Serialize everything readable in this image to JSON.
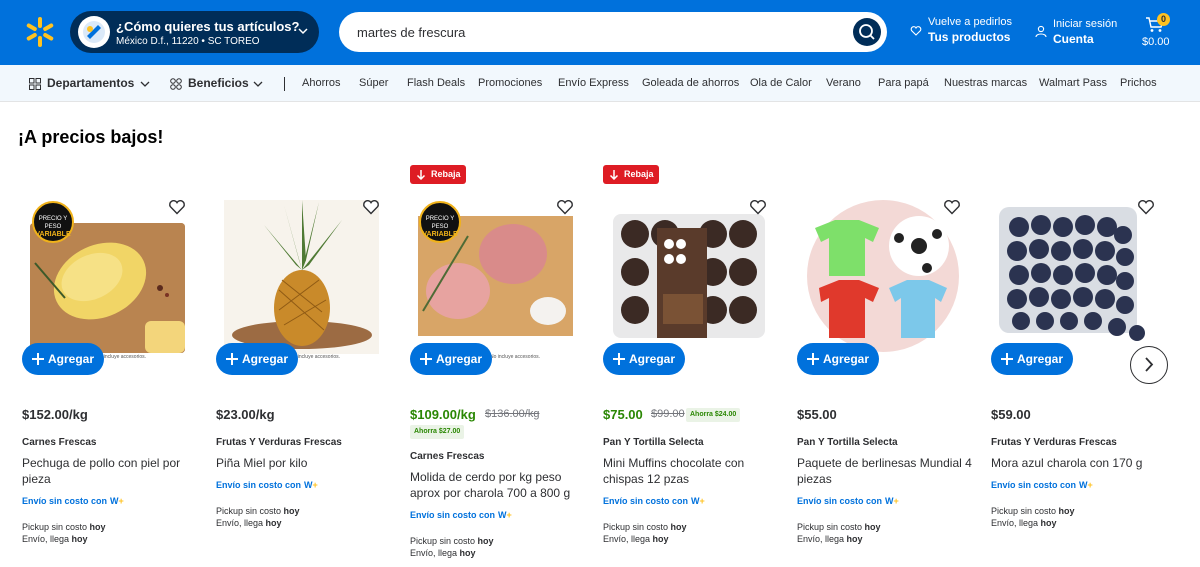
{
  "header": {
    "delivery_title": "¿Cómo quieres tus artículos?",
    "delivery_address": "México D.f., 11220 • SC TOREO",
    "search_value": "martes de frescura",
    "reorder_small": "Vuelve a pedirlos",
    "reorder_big": "Tus productos",
    "account_small": "Iniciar sesión",
    "account_big": "Cuenta",
    "cart_count": "0",
    "cart_total": "$0.00"
  },
  "subnav": {
    "departments": "Departamentos",
    "benefits": "Beneficios",
    "links": [
      "Ahorros",
      "Súper",
      "Flash Deals",
      "Promociones",
      "Envío Express",
      "Goleada de ahorros",
      "Ola de Calor",
      "Verano",
      "Para papá",
      "Nuestras marcas",
      "Walmart Pass",
      "Prichos"
    ]
  },
  "section_title": "¡A precios bajos!",
  "products": [
    {
      "price": "$152.00/kg",
      "brand": "Carnes Frescas",
      "name": "Pechuga de pollo con piel por pieza",
      "ship": "Envío sin costo con",
      "pickup": "Pickup sin costo",
      "pickup_when": "hoy",
      "delivery": "Envío, llega",
      "delivery_when": "hoy",
      "add": "Agregar",
      "variable_top": "PRECIO Y PESO",
      "variable_bottom": "VARIABLE",
      "note": "No incluye accesorios."
    },
    {
      "price": "$23.00/kg",
      "brand": "Frutas Y Verduras Frescas",
      "name": "Piña Miel por kilo",
      "ship": "Envío sin costo con",
      "pickup": "Pickup sin costo",
      "pickup_when": "hoy",
      "delivery": "Envío, llega",
      "delivery_when": "hoy",
      "add": "Agregar",
      "note": "No incluye accesorios."
    },
    {
      "badge": "Rebaja",
      "price": "$109.00/kg",
      "was": "$136.00/kg",
      "save": "Ahorra $27.00",
      "brand": "Carnes Frescas",
      "name": "Molida de cerdo por kg peso aprox por charola 700 a 800 g",
      "ship": "Envío sin costo con",
      "pickup": "Pickup sin costo",
      "pickup_when": "hoy",
      "delivery": "Envío, llega",
      "delivery_when": "hoy",
      "add": "Agregar",
      "variable_top": "PRECIO Y PESO",
      "variable_bottom": "VARIABLE",
      "note": "No incluye accesorios."
    },
    {
      "badge": "Rebaja",
      "price": "$75.00",
      "was": "$99.00",
      "save": "Ahorra $24.00",
      "brand": "Pan Y Tortilla Selecta",
      "name": "Mini Muffins chocolate con chispas 12 pzas",
      "ship": "Envío sin costo con",
      "pickup": "Pickup sin costo",
      "pickup_when": "hoy",
      "delivery": "Envío, llega",
      "delivery_when": "hoy",
      "add": "Agregar"
    },
    {
      "price": "$55.00",
      "brand": "Pan Y Tortilla Selecta",
      "name": "Paquete de berlinesas Mundial 4 piezas",
      "ship": "Envío sin costo con",
      "pickup": "Pickup sin costo",
      "pickup_when": "hoy",
      "delivery": "Envío, llega",
      "delivery_when": "hoy",
      "add": "Agregar"
    },
    {
      "price": "$59.00",
      "brand": "Frutas Y Verduras Frescas",
      "name": "Mora azul charola con 170 g",
      "ship": "Envío sin costo con",
      "pickup": "Pickup sin costo",
      "pickup_when": "hoy",
      "delivery": "Envío, llega",
      "delivery_when": "hoy",
      "add": "Agregar"
    }
  ],
  "wplus": "W+",
  "colors": {
    "brand_blue": "#0071dc",
    "navy": "#002d58",
    "spark_yellow": "#ffc220",
    "rebaja_red": "#de1c24",
    "savings_green": "#2a8703"
  }
}
